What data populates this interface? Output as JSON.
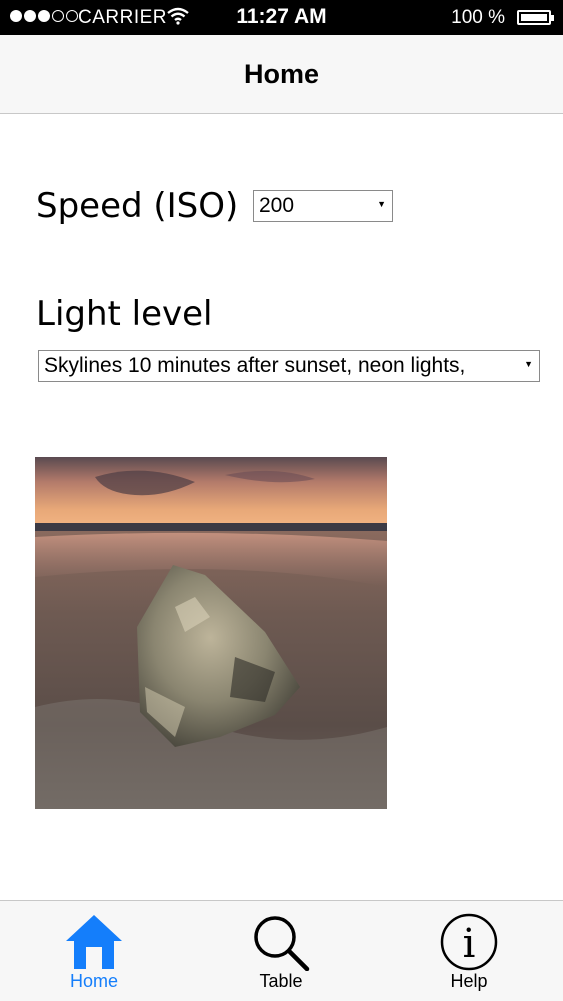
{
  "status_bar": {
    "carrier": "CARRIER",
    "time": "11:27 AM",
    "battery": "100 %",
    "signal_bars_filled": 3,
    "signal_bars_total": 5
  },
  "nav": {
    "title": "Home"
  },
  "form": {
    "speed_label": "Speed (ISO)",
    "speed_value": "200",
    "light_label": "Light level",
    "light_value": "Skylines 10 minutes after sunset, neon lights,"
  },
  "image": {
    "subject": "rock on beach at sunset"
  },
  "tabs": [
    {
      "label": "Home",
      "icon": "home-icon",
      "selected": true
    },
    {
      "label": "Table",
      "icon": "search-icon",
      "selected": false
    },
    {
      "label": "Help",
      "icon": "info-icon",
      "selected": false
    }
  ],
  "colors": {
    "accent": "#147efb",
    "status_bar": "#000000",
    "bar_background": "#f7f7f7"
  }
}
